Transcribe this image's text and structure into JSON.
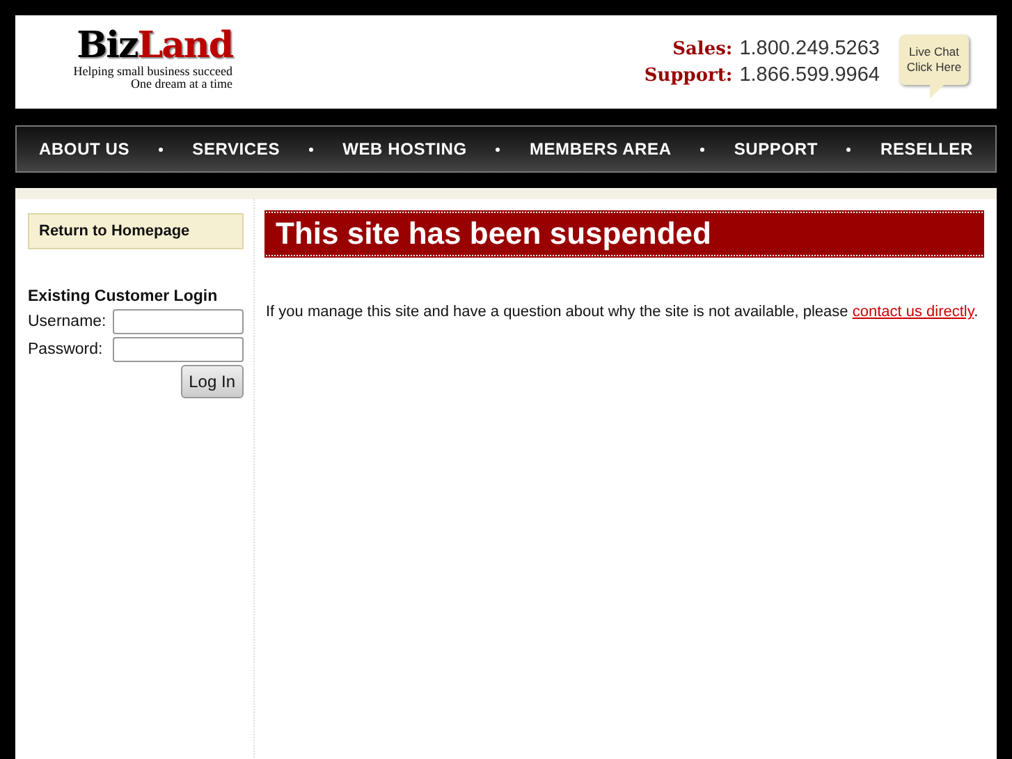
{
  "header": {
    "logo": {
      "part_1": "Biz",
      "part_2": "Land"
    },
    "tagline": [
      "Helping small business succeed",
      "One dream at a time"
    ],
    "contacts": [
      {
        "label": "Sales:",
        "number": "1.800.249.5263"
      },
      {
        "label": "Support:",
        "number": "1.866.599.9964"
      }
    ],
    "live_chat": [
      "Live Chat",
      "Click Here"
    ]
  },
  "nav": [
    "ABOUT US",
    "SERVICES",
    "WEB HOSTING",
    "MEMBERS AREA",
    "SUPPORT",
    "RESELLER"
  ],
  "sidebar": {
    "return_link": "Return to Homepage",
    "login": {
      "title": "Existing Customer Login",
      "fields": [
        {
          "label": "Username:"
        },
        {
          "label": "Password:"
        }
      ],
      "button": "Log In"
    }
  },
  "main": {
    "title": "This site has been suspended",
    "message": "If you manage this site and have a question about why the site is not available, please ",
    "link": "contact us directly",
    "message_end": "."
  }
}
